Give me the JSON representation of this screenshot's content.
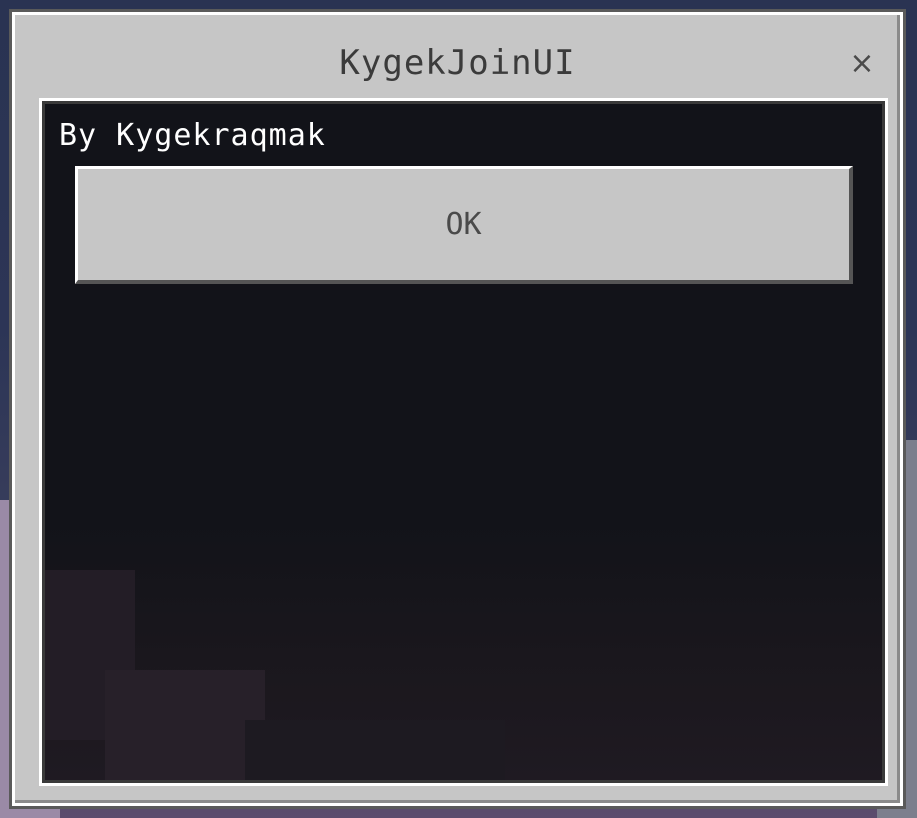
{
  "dialog": {
    "title": "KygekJoinUI",
    "close_label": "×",
    "content_text": "By Kygekraqmak",
    "buttons": [
      {
        "label": "OK"
      }
    ]
  }
}
